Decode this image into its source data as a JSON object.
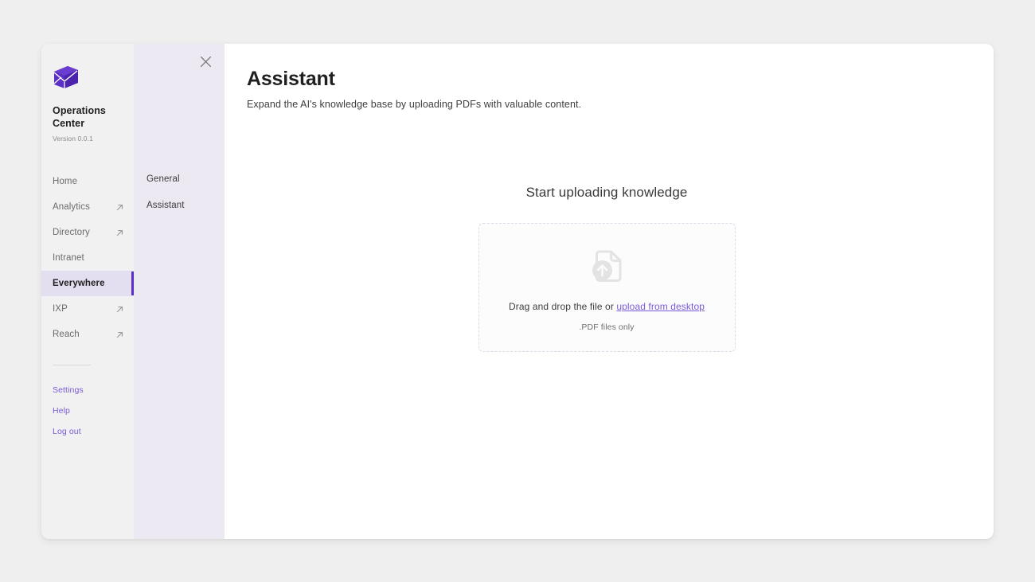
{
  "brand": {
    "logo_icon": "cube-envelope-logo",
    "name": "Operations Center",
    "version": "Version 0.0.1"
  },
  "sidebar": {
    "items": [
      {
        "label": "Home",
        "external": false,
        "active": false
      },
      {
        "label": "Analytics",
        "external": true,
        "active": false
      },
      {
        "label": "Directory",
        "external": true,
        "active": false
      },
      {
        "label": "Intranet",
        "external": false,
        "active": false
      },
      {
        "label": "Everywhere",
        "external": false,
        "active": true
      },
      {
        "label": "IXP",
        "external": true,
        "active": false
      },
      {
        "label": "Reach",
        "external": true,
        "active": false
      }
    ],
    "footer_links": [
      {
        "label": "Settings"
      },
      {
        "label": "Help"
      },
      {
        "label": "Log out"
      }
    ],
    "external_icon": "external-link-arrow-icon"
  },
  "secondary_panel": {
    "close_icon": "close-icon",
    "items": [
      {
        "label": "General"
      },
      {
        "label": "Assistant"
      }
    ]
  },
  "main": {
    "title": "Assistant",
    "subtitle": "Expand the AI's knowledge base by uploading PDFs with valuable content.",
    "upload": {
      "heading": "Start uploading knowledge",
      "icon": "file-upload-icon",
      "primary_text": "Drag and drop the file or",
      "link_text": "upload from desktop",
      "hint": ".PDF files only"
    }
  },
  "colors": {
    "accent": "#5b2ec4",
    "link": "#7a5ad6",
    "sidebar_bg": "#f1f1f1",
    "panel_bg": "#ece9f2",
    "active_bg": "#e4dff0",
    "page_bg": "#efefef"
  }
}
